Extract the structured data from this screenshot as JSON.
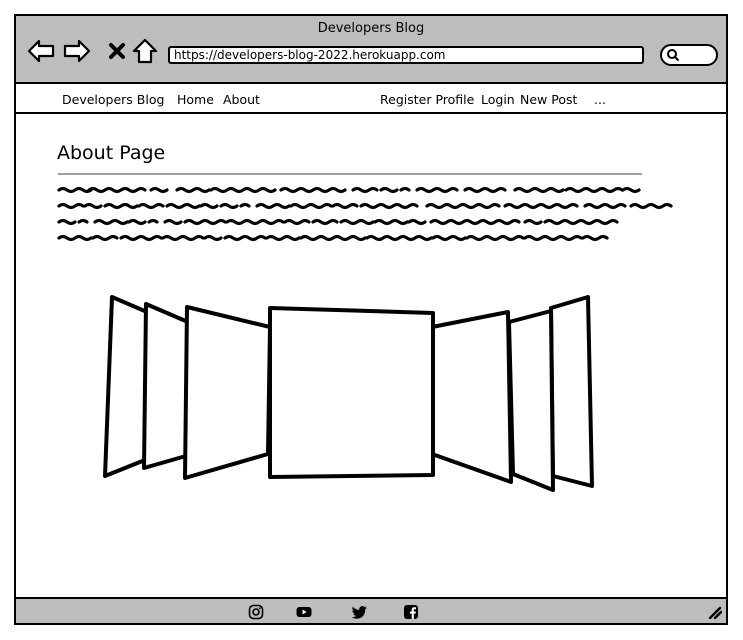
{
  "browser": {
    "title": "Developers Blog",
    "url": "https://developers-blog-2022.herokuapp.com"
  },
  "navbar": {
    "brand": "Developers Blog",
    "links": [
      "Home",
      "About"
    ],
    "right_links": [
      "Register Profile",
      "Login",
      "New Post",
      "..."
    ]
  },
  "main": {
    "heading": "About Page"
  },
  "footer": {
    "icons": [
      "instagram-icon",
      "youtube-icon",
      "twitter-icon",
      "facebook-icon"
    ]
  },
  "colors": {
    "chrome": "#bdbdbd",
    "rule": "#9e9e9e"
  }
}
